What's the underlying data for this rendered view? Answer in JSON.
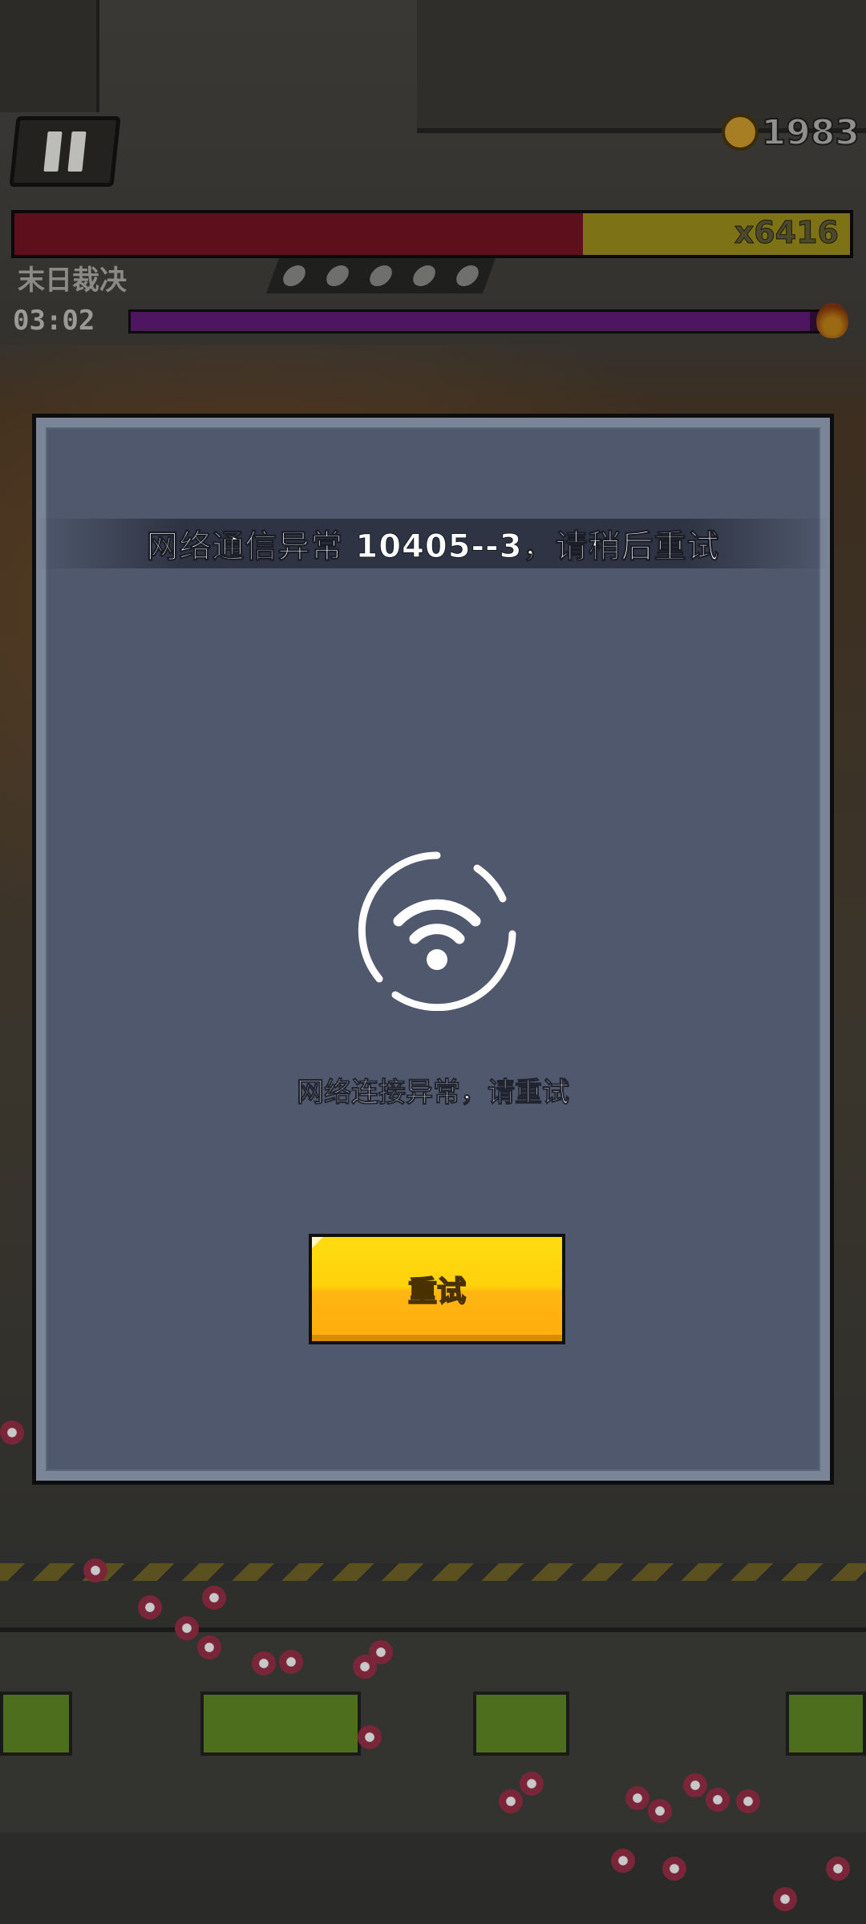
{
  "hud": {
    "coin_value": "1983",
    "hp_multiplier": "x6416",
    "hp_fraction": 0.68,
    "boss_name": "末日裁决",
    "timer": "03:02",
    "timer_fraction": 0.98,
    "icons": [
      "pause-icon",
      "medal-coin-icon",
      "fire-icon",
      "skill-icon-1",
      "skill-icon-2",
      "skill-icon-3",
      "skill-icon-4",
      "skill-icon-5"
    ]
  },
  "dialog": {
    "title": "网络通信异常 10405--3，请稍后重试",
    "message": "网络连接异常，请重试",
    "icon": "wifi-loading-icon",
    "retry_label": "重试"
  },
  "colors": {
    "dialog_frame": "#7b8598",
    "dialog_body": "#4f586d",
    "retry_yellow": "#ffd20b",
    "retry_orange": "#ffad0b"
  }
}
